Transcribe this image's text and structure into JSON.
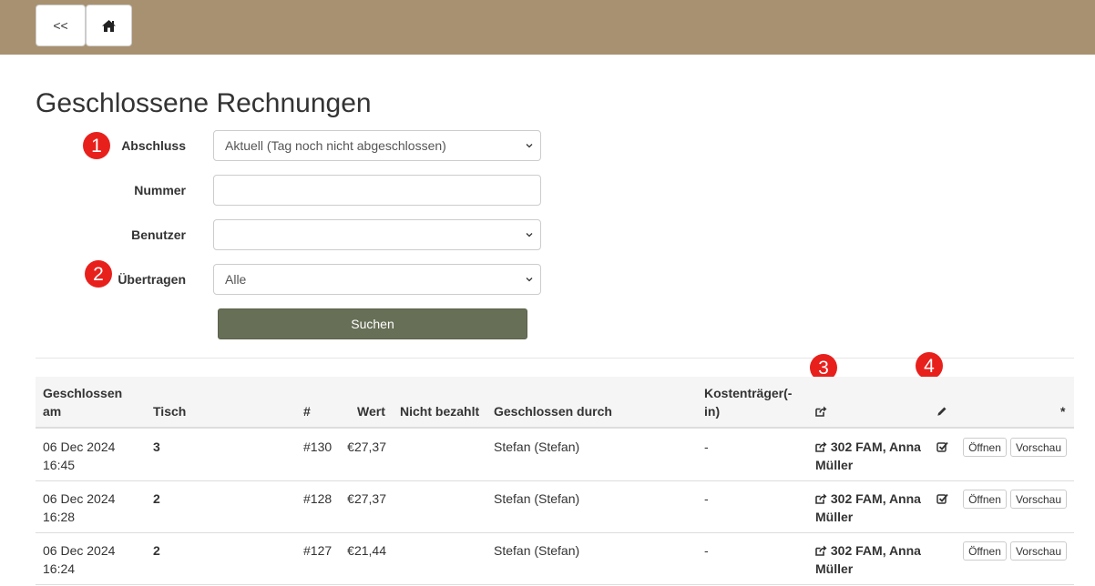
{
  "nav": {
    "back_label": "<<",
    "home_icon": "home-icon"
  },
  "page": {
    "title": "Geschlossene Rechnungen"
  },
  "filters": {
    "abschluss": {
      "label": "Abschluss",
      "value": "Aktuell (Tag noch nicht abgeschlossen)"
    },
    "nummer": {
      "label": "Nummer",
      "value": ""
    },
    "benutzer": {
      "label": "Benutzer",
      "value": ""
    },
    "uebertragen": {
      "label": "Übertragen",
      "value": "Alle"
    },
    "search_label": "Suchen"
  },
  "markers": [
    "1",
    "2",
    "3",
    "4"
  ],
  "table": {
    "headers": {
      "closed_at": "Geschlossen am",
      "table": "Tisch",
      "number": "#",
      "value": "Wert",
      "unpaid": "Nicht bezahlt",
      "closed_by": "Geschlossen durch",
      "cost_bearer": "Kostenträger(-in)",
      "transferred_icon": "share-icon",
      "edit_icon": "pencil-icon",
      "star": "*"
    },
    "rows": [
      {
        "date": "06 Dec 2024",
        "time": "16:45",
        "table": "3",
        "number": "#130",
        "value": "€27,37",
        "unpaid": "",
        "closed_by": "Stefan (Stefan)",
        "cost_bearer": "-",
        "transfer": "302 FAM, Anna Müller",
        "checked": true,
        "open_label": "Öffnen",
        "preview_label": "Vorschau"
      },
      {
        "date": "06 Dec 2024",
        "time": "16:28",
        "table": "2",
        "number": "#128",
        "value": "€27,37",
        "unpaid": "",
        "closed_by": "Stefan (Stefan)",
        "cost_bearer": "-",
        "transfer": "302 FAM, Anna Müller",
        "checked": true,
        "open_label": "Öffnen",
        "preview_label": "Vorschau"
      },
      {
        "date": "06 Dec 2024",
        "time": "16:24",
        "table": "2",
        "number": "#127",
        "value": "€21,44",
        "unpaid": "",
        "closed_by": "Stefan (Stefan)",
        "cost_bearer": "-",
        "transfer": "302 FAM, Anna Müller",
        "checked": false,
        "open_label": "Öffnen",
        "preview_label": "Vorschau"
      }
    ]
  }
}
